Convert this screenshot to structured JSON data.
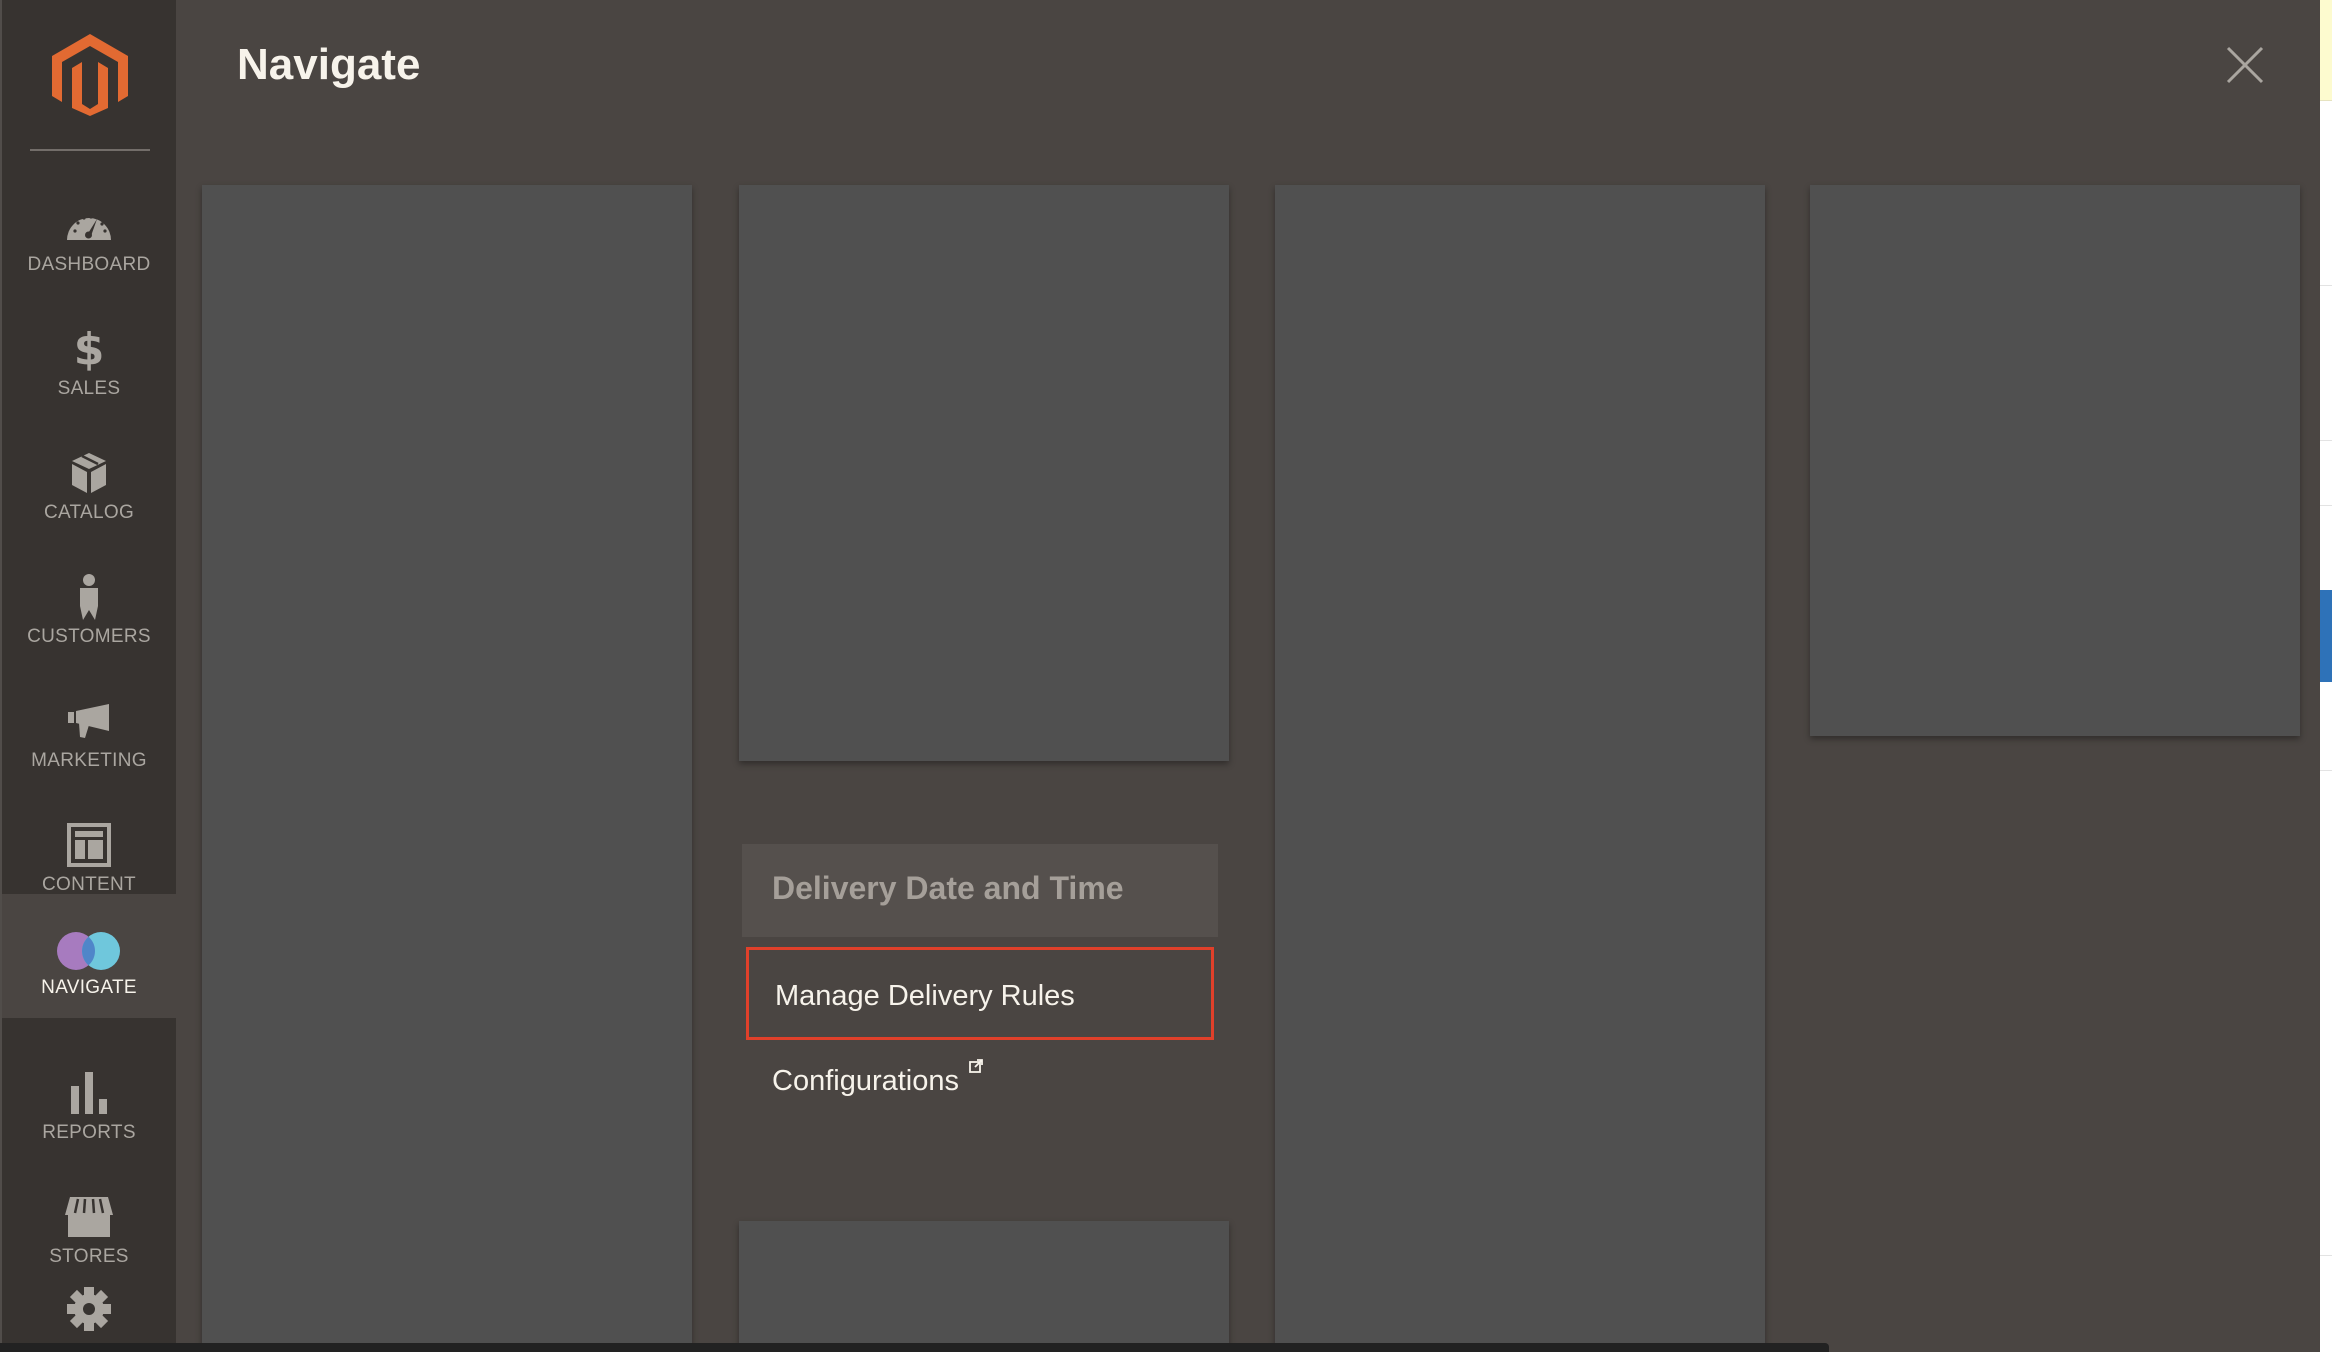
{
  "sidebar": {
    "logo": "magento-logo",
    "items": [
      {
        "label": "DASHBOARD",
        "icon": "dashboard-gauge-icon",
        "active": false
      },
      {
        "label": "SALES",
        "icon": "dollar-icon",
        "active": false
      },
      {
        "label": "CATALOG",
        "icon": "box-icon",
        "active": false
      },
      {
        "label": "CUSTOMERS",
        "icon": "person-icon",
        "active": false
      },
      {
        "label": "MARKETING",
        "icon": "megaphone-icon",
        "active": false
      },
      {
        "label": "CONTENT",
        "icon": "layout-icon",
        "active": false
      },
      {
        "label": "NAVIGATE",
        "icon": "overlapping-circles-icon",
        "active": true
      },
      {
        "label": "REPORTS",
        "icon": "bar-chart-icon",
        "active": false
      },
      {
        "label": "STORES",
        "icon": "storefront-icon",
        "active": false
      },
      {
        "label": "",
        "icon": "gear-icon",
        "active": false
      }
    ]
  },
  "overlay": {
    "title": "Navigate",
    "close_icon": "close-icon",
    "menu_section": {
      "heading": "Delivery Date and Time",
      "links": [
        {
          "label": "Manage Delivery Rules",
          "highlighted": true
        },
        {
          "label": "Configurations",
          "external": true
        }
      ]
    }
  },
  "colors": {
    "brand_orange": "#e26a32",
    "highlight_border": "#e0402a",
    "sidebar_bg": "#373330",
    "overlay_bg": "#4a4542",
    "panel_bg": "#505050"
  }
}
